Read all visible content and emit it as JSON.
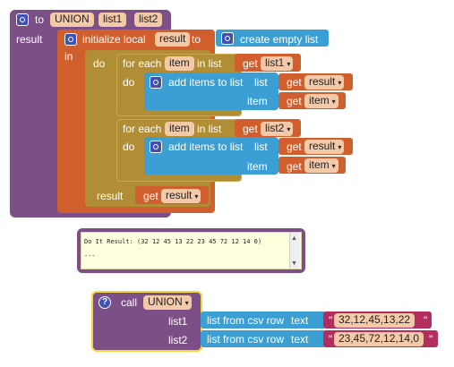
{
  "proc": {
    "to_label": "to",
    "name": "UNION",
    "params": [
      "list1",
      "list2"
    ],
    "result_label": "result"
  },
  "init_local": {
    "label": "initialize local",
    "var_name": "result",
    "to_label": "to",
    "in_label": "in",
    "value_label": "create empty list"
  },
  "do_block": {
    "do_label": "do",
    "result_label": "result"
  },
  "loop1": {
    "for_each_label": "for each",
    "item_var": "item",
    "in_list_label": "in list",
    "get_label": "get",
    "list_var": "list1",
    "do_label": "do",
    "add_items_label": "add items to list",
    "list_label": "list",
    "item_label": "item",
    "target_var": "result",
    "source_var": "item"
  },
  "loop2": {
    "for_each_label": "for each",
    "item_var": "item",
    "in_list_label": "in list",
    "get_label": "get",
    "list_var": "list2",
    "do_label": "do",
    "add_items_label": "add items to list",
    "list_label": "list",
    "item_label": "item",
    "target_var": "result",
    "source_var": "item"
  },
  "final_get": {
    "get_label": "get",
    "var": "result"
  },
  "do_it": {
    "result_text": "Do It Result: (32 12 45 13 22 23 45 72 12 14 0)",
    "dashes": "---"
  },
  "call_block": {
    "help": "?",
    "call_label": "call",
    "proc_name": "UNION",
    "param1": "list1",
    "param2": "list2",
    "csv_label": "list from csv row",
    "text_label": "text",
    "value1": "32,12,45,13,22",
    "value2": "23,45,72,12,14,0",
    "quote": "\""
  },
  "colors": {
    "procedure": "#7d4f87",
    "variable": "#d05f2d",
    "control": "#b18e35",
    "list": "#3c9fd4",
    "text": "#b32d5e",
    "param_slot": "#f4c9a8"
  }
}
